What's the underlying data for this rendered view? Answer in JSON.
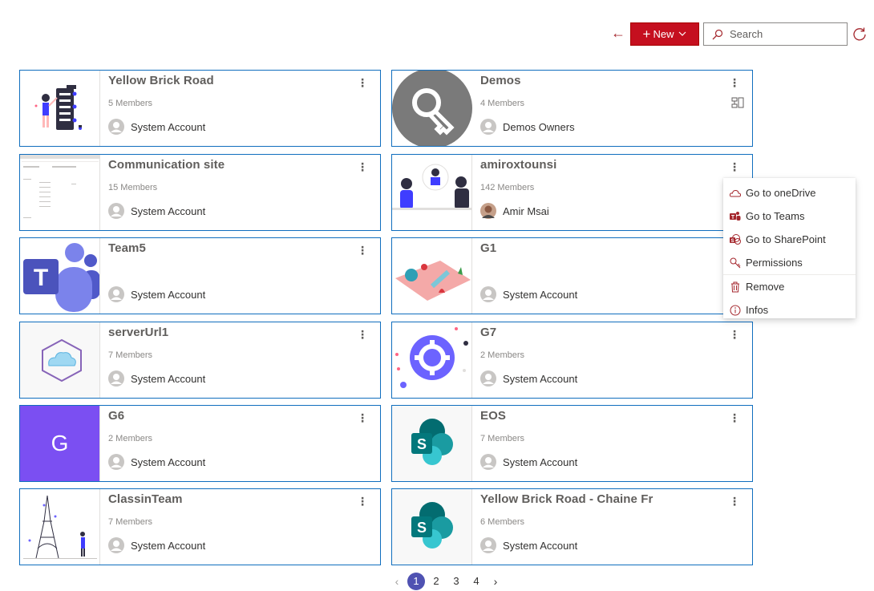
{
  "toolbar": {
    "new_label": "New",
    "search_placeholder": "Search"
  },
  "cards": [
    {
      "title": "Yellow Brick Road",
      "members": "5 Members",
      "owner": "System Account"
    },
    {
      "title": "Demos",
      "members": "4 Members",
      "owner": "Demos Owners"
    },
    {
      "title": "Communication site",
      "members": "15 Members",
      "owner": "System Account"
    },
    {
      "title": "amiroxtounsi",
      "members": "142 Members",
      "owner": "Amir Msai"
    },
    {
      "title": "Team5",
      "members": "",
      "owner": "System Account"
    },
    {
      "title": "G1",
      "members": "",
      "owner": "System Account"
    },
    {
      "title": "serverUrl1",
      "members": "7 Members",
      "owner": "System Account"
    },
    {
      "title": "G7",
      "members": "2 Members",
      "owner": "System Account"
    },
    {
      "title": "G6",
      "members": "2 Members",
      "owner": "System Account",
      "initial": "G"
    },
    {
      "title": "EOS",
      "members": "7 Members",
      "owner": "System Account"
    },
    {
      "title": "ClassinTeam",
      "members": "7 Members",
      "owner": "System Account"
    },
    {
      "title": "Yellow Brick Road - Chaine Fr",
      "members": "6 Members",
      "owner": "System Account"
    }
  ],
  "menu": {
    "items": [
      "Go to oneDrive",
      "Go to Teams",
      "Go to SharePoint",
      "Permissions",
      "Remove",
      "Infos"
    ]
  },
  "pagination": {
    "pages": [
      "1",
      "2",
      "3",
      "4"
    ]
  },
  "colors": {
    "accent": "#c50f1f",
    "border": "#106ebe",
    "active_page": "#4f52b2"
  }
}
